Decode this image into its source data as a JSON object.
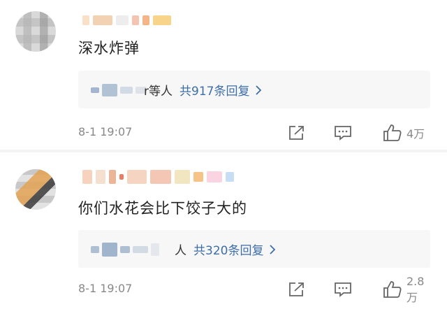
{
  "comments": [
    {
      "text": "深水炸弹",
      "reply_others": "r等人",
      "reply_count": "共917条回复",
      "timestamp": "8-1 19:07",
      "likes": "4万",
      "name_blur_colors": [
        "#f6d9b8",
        "#f0c6a0",
        "#e8e8e8",
        "#f3b59c",
        "#f1a46a",
        "#f5c96b"
      ],
      "reply_blur_colors": [
        "#8ca5c4",
        "#9fb4cc",
        "#c7d3e0",
        "#d8dde5"
      ]
    },
    {
      "text": "你们水花会比下饺子大的",
      "reply_others": "人",
      "reply_count": "共320条回复",
      "timestamp": "8-1 19:07",
      "likes": "2.8万",
      "name_blur_colors": [
        "#f4c8ae",
        "#f3d7c3",
        "#e6a37d",
        "#e65a3c",
        "#f3c9b2",
        "#f1b8a1",
        "#efe0b0",
        "#f4b46a",
        "#f9c9d8",
        "#b9d5f0"
      ],
      "reply_blur_colors": [
        "#9bb0c8",
        "#8aa2bf",
        "#c8d2dd",
        "#dfe3e8"
      ]
    }
  ],
  "colors": {
    "link": "#3d6ea8",
    "muted": "#888888",
    "reply_bg": "#f7f7f7"
  },
  "icons": [
    "share-icon",
    "comment-icon",
    "like-icon",
    "chevron-right-icon"
  ]
}
